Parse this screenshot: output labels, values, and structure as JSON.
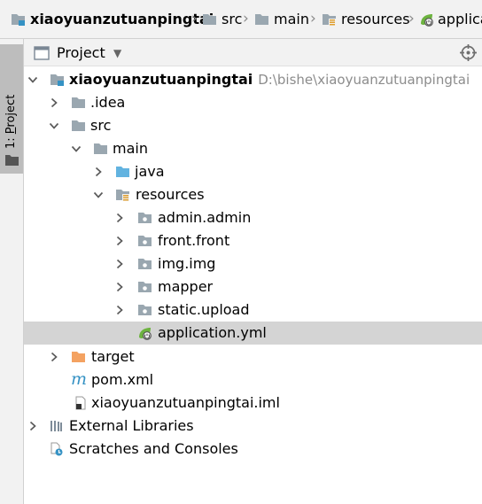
{
  "breadcrumb": {
    "items": [
      {
        "label": "xiaoyuanzutuanpingtai",
        "icon": "module-folder-icon"
      },
      {
        "label": "src",
        "icon": "folder-icon"
      },
      {
        "label": "main",
        "icon": "folder-icon"
      },
      {
        "label": "resources",
        "icon": "resources-folder-icon"
      },
      {
        "label": "applica",
        "icon": "spring-config-icon"
      }
    ]
  },
  "stripe": {
    "label_prefix": "1:",
    "label_underlined": "P",
    "label_rest": "roject"
  },
  "panel": {
    "title": "Project",
    "icon": "project-window-icon"
  },
  "tree": [
    {
      "label": "xiaoyuanzutuanpingtai",
      "path": "D:\\bishe\\xiaoyuanzutuanpingtai",
      "icon": "module-folder-icon",
      "expanded": true
    },
    {
      "label": ".idea",
      "icon": "folder-icon",
      "expanded": false
    },
    {
      "label": "src",
      "icon": "folder-icon",
      "expanded": true
    },
    {
      "label": "main",
      "icon": "folder-icon",
      "expanded": true
    },
    {
      "label": "java",
      "icon": "source-folder-icon",
      "expanded": false
    },
    {
      "label": "resources",
      "icon": "resources-folder-icon",
      "expanded": true
    },
    {
      "label": "admin.admin",
      "icon": "package-folder-icon",
      "expanded": false
    },
    {
      "label": "front.front",
      "icon": "package-folder-icon",
      "expanded": false
    },
    {
      "label": "img.img",
      "icon": "package-folder-icon",
      "expanded": false
    },
    {
      "label": "mapper",
      "icon": "package-folder-icon",
      "expanded": false
    },
    {
      "label": "static.upload",
      "icon": "package-folder-icon",
      "expanded": false
    },
    {
      "label": "application.yml",
      "icon": "spring-config-icon",
      "selected": true
    },
    {
      "label": "target",
      "icon": "excluded-folder-icon",
      "expanded": false
    },
    {
      "label": "pom.xml",
      "icon": "maven-icon"
    },
    {
      "label": "xiaoyuanzutuanpingtai.iml",
      "icon": "iml-file-icon"
    },
    {
      "label": "External Libraries",
      "icon": "libraries-icon",
      "expanded": false
    },
    {
      "label": "Scratches and Consoles",
      "icon": "scratches-icon"
    }
  ],
  "colors": {
    "folder": "#9aa7b0",
    "source_folder": "#62b3e0",
    "excluded_folder": "#f4a261",
    "spring": "#6db33f",
    "selection": "#d4d4d4"
  }
}
